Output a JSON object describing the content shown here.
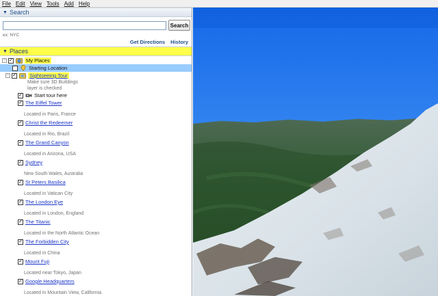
{
  "menu": {
    "items": [
      {
        "label": "File"
      },
      {
        "label": "Edit"
      },
      {
        "label": "View"
      },
      {
        "label": "Tools"
      },
      {
        "label": "Add"
      },
      {
        "label": "Help"
      }
    ]
  },
  "search": {
    "title": "Search",
    "input_value": "",
    "button_label": "Search",
    "hint": "ex: NYC",
    "get_directions": "Get Directions",
    "history": "History"
  },
  "places": {
    "title": "Places",
    "my_places": "My Places",
    "starting_location": "Starting Location",
    "tour": {
      "label": "Sightseeing Tour",
      "note": [
        "Make sure 3D Buildings",
        "layer is checked"
      ],
      "start_label": "Start tour here",
      "items": [
        {
          "label": "The Eiffel Tower",
          "desc": "Located in Paris, France"
        },
        {
          "label": "Christ the Redeemer",
          "desc": "Located in Rio, Brazil"
        },
        {
          "label": "The Grand Canyon",
          "desc": "Located in Arizona, USA"
        },
        {
          "label": "Sydney",
          "desc": "New South Wales, Australia"
        },
        {
          "label": "St Peters Basilica",
          "desc": "Located in Vatican City"
        },
        {
          "label": "The London Eye",
          "desc": "Located in London, England"
        },
        {
          "label": "The Titanic",
          "desc": "Located in the North Atlantic Ocean"
        },
        {
          "label": "The Forbidden City",
          "desc": "Located in China"
        },
        {
          "label": "Mount Fuji",
          "desc": "Located near Tokyo, Japan"
        },
        {
          "label": "Google Headquarters",
          "desc": "Located in Mountain View, California"
        }
      ]
    }
  },
  "colors": {
    "highlight": "#ffff4a",
    "selection": "#99ccff",
    "link": "#1a35c8",
    "header_text": "#1f4f8a"
  },
  "icons": {
    "my_places": "folder-globe-icon",
    "starting_location": "placemark-pin-icon",
    "tour": "folder-tour-icon",
    "start_tour": "tour-camera-icon"
  }
}
